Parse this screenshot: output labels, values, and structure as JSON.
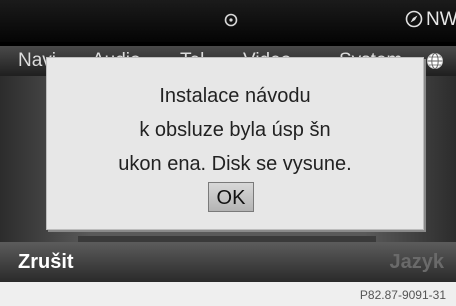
{
  "status": {
    "heading": "NW",
    "icons": [
      "disc-icon",
      "compass-icon"
    ]
  },
  "menu": {
    "items": [
      "Navi",
      "Audio",
      "Tel",
      "Video",
      "System"
    ],
    "icon": "globe-icon"
  },
  "dialog": {
    "lines": [
      "Instalace návodu",
      "k obsluze byla úsp šn",
      "ukon ena. Disk se vysune."
    ],
    "ok_label": "OK"
  },
  "bottombar": {
    "cancel_label": "Zrušit",
    "language_label": "Jazyk"
  },
  "figure_id": "P82.87-9091-31"
}
